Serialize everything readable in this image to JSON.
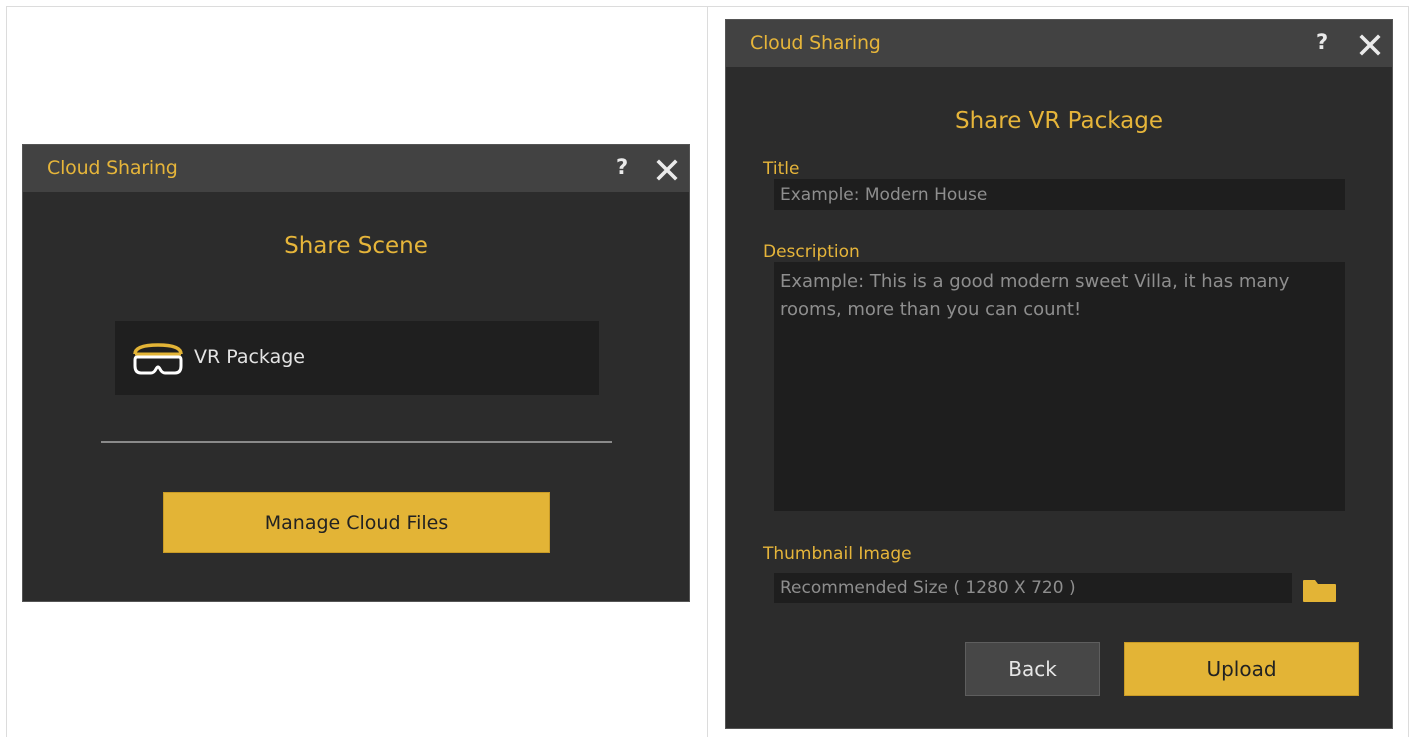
{
  "colors": {
    "accent": "#e6b53a",
    "dialog_bg": "#2c2c2c",
    "titlebar_bg": "#424242",
    "field_bg": "#1e1e1e"
  },
  "left_dialog": {
    "title": "Cloud Sharing",
    "help_label": "?",
    "close_icon": "close-icon",
    "heading": "Share Scene",
    "vr_option": {
      "icon": "vr-headset-icon",
      "label": "VR Package"
    },
    "manage_button": "Manage Cloud Files"
  },
  "right_dialog": {
    "title": "Cloud Sharing",
    "help_label": "?",
    "close_icon": "close-icon",
    "heading": "Share VR Package",
    "title_field": {
      "label": "Title",
      "value": "",
      "placeholder": "Example: Modern House"
    },
    "description_field": {
      "label": "Description",
      "value": "",
      "placeholder": "Example: This is a good modern sweet Villa, it has many rooms, more than you can count!"
    },
    "thumbnail_field": {
      "label": "Thumbnail Image",
      "value": "",
      "placeholder": "Recommended Size ( 1280 X 720 )",
      "browse_icon": "folder-icon"
    },
    "back_button": "Back",
    "upload_button": "Upload"
  }
}
